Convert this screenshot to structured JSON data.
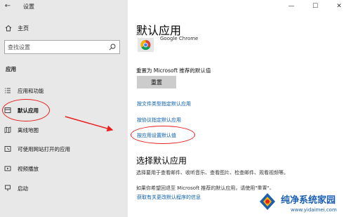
{
  "window": {
    "title": "设置",
    "controls": {
      "minimize": "—",
      "maximize": "☐",
      "close": "✕"
    }
  },
  "sidebar": {
    "home_label": "主页",
    "search_placeholder": "查找设置",
    "section_label": "应用",
    "items": [
      {
        "label": "应用和功能",
        "icon": "list-icon"
      },
      {
        "label": "默认应用",
        "icon": "default-apps-icon",
        "active": true
      },
      {
        "label": "离线地图",
        "icon": "map-icon"
      },
      {
        "label": "可使用网站打开的应用",
        "icon": "website-icon"
      },
      {
        "label": "视频播放",
        "icon": "video-icon"
      },
      {
        "label": "启动",
        "icon": "startup-icon"
      }
    ]
  },
  "main": {
    "title": "默认应用",
    "chrome_label": "Google Chrome",
    "reset_text": "重置为 Microsoft 推荐的默认值",
    "reset_button": "重置",
    "links": [
      "按文件类型指定默认应用",
      "按协议指定默认应用",
      "按应用设置默认值"
    ],
    "choose_title": "选择默认应用",
    "choose_desc": "选择要用于查看邮件、收听音乐、查看图片、检查邮件、观看视频等。",
    "reset_desc": "如果你希望回退至 Microsoft 推荐的默认应用，请使用\"重置\"。",
    "recommend_link": "获取有关更改默认程序的信息"
  },
  "watermark": {
    "title": "纯净系统家园",
    "url": "www.yidaimei.com"
  },
  "colors": {
    "sidebar_bg": "#e8e8e8",
    "link": "#0a5fb0",
    "annotation_red": "#e82020",
    "button_bg": "#cccccc"
  }
}
